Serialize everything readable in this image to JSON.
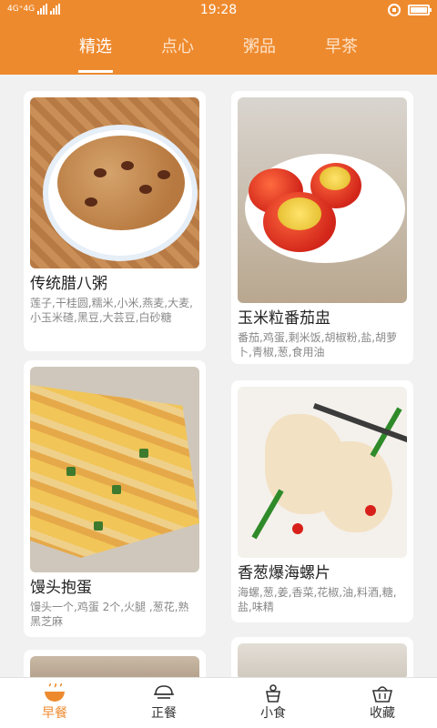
{
  "status_bar": {
    "network": "4G⁺4G",
    "time": "19:28",
    "icons": [
      "signal-icon",
      "rotation-lock-icon",
      "battery-icon"
    ]
  },
  "top_tabs": [
    {
      "label": "精选",
      "active": true
    },
    {
      "label": "点心",
      "active": false
    },
    {
      "label": "粥品",
      "active": false
    },
    {
      "label": "早茶",
      "active": false
    }
  ],
  "recipes": [
    {
      "title": "传统腊八粥",
      "ingredients": "莲子,干桂圆,糯米,小米,燕麦,大麦,小玉米碴,黑豆,大芸豆,白砂糖"
    },
    {
      "title": "玉米粒番茄盅",
      "ingredients": "番茄,鸡蛋,剩米饭,胡椒粉,盐,胡萝卜,青椒,葱,食用油"
    },
    {
      "title": "馒头抱蛋",
      "ingredients": "馒头一个,鸡蛋 2个,火腿 ,葱花,熟黑芝麻"
    },
    {
      "title": "香葱爆海螺片",
      "ingredients": "海螺,葱,姜,香菜,花椒,油,料酒,糖,盐,味精"
    }
  ],
  "bottom_nav": [
    {
      "label": "早餐",
      "icon": "bowl-icon",
      "active": true
    },
    {
      "label": "正餐",
      "icon": "dish-icon",
      "active": false
    },
    {
      "label": "小食",
      "icon": "snack-icon",
      "active": false
    },
    {
      "label": "收藏",
      "icon": "basket-icon",
      "active": false
    }
  ],
  "colors": {
    "accent": "#ee8a2e",
    "background": "#f1f1f1",
    "card": "#ffffff"
  }
}
